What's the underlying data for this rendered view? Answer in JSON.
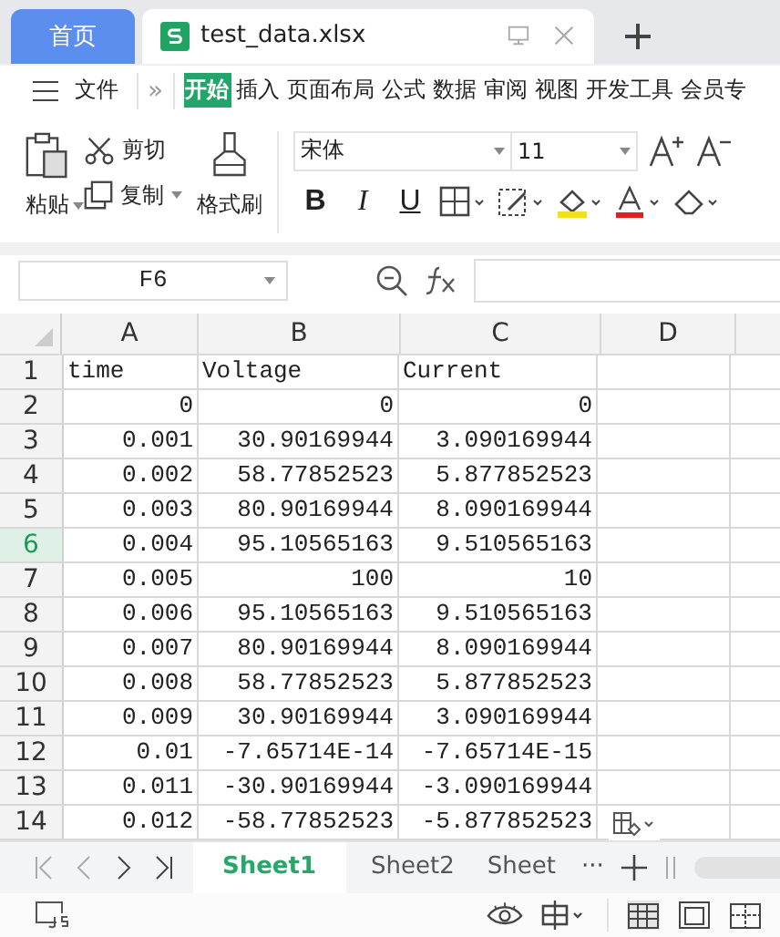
{
  "tabs": [
    {
      "label": "首页",
      "kind": "home",
      "selected": false
    },
    {
      "label": "test_data.xlsx",
      "kind": "doc",
      "selected": true
    }
  ],
  "menu": {
    "file": "文件",
    "more": "»",
    "items": [
      {
        "label": "开始",
        "selected": true
      },
      {
        "label": "插入",
        "selected": false
      },
      {
        "label": "页面布局",
        "selected": false
      },
      {
        "label": "公式",
        "selected": false
      },
      {
        "label": "数据",
        "selected": false
      },
      {
        "label": "审阅",
        "selected": false
      },
      {
        "label": "视图",
        "selected": false
      },
      {
        "label": "开发工具",
        "selected": false
      },
      {
        "label": "会员专",
        "selected": false
      }
    ]
  },
  "ribbon": {
    "paste": "粘贴",
    "cut": "剪切",
    "copy": "复制",
    "format_painter": "格式刷",
    "font": "宋体",
    "size": "11",
    "bold": "B",
    "italic": "I",
    "underline": "U"
  },
  "name_box": "F6",
  "columns": [
    "A",
    "B",
    "C",
    "D"
  ],
  "rows": [
    {
      "n": "1",
      "selected": false,
      "cells": [
        "time",
        "Voltage",
        "Current"
      ]
    },
    {
      "n": "2",
      "selected": false,
      "cells": [
        "0",
        "0",
        "0"
      ]
    },
    {
      "n": "3",
      "selected": false,
      "cells": [
        "0.001",
        "30.90169944",
        "3.090169944"
      ]
    },
    {
      "n": "4",
      "selected": false,
      "cells": [
        "0.002",
        "58.77852523",
        "5.877852523"
      ]
    },
    {
      "n": "5",
      "selected": false,
      "cells": [
        "0.003",
        "80.90169944",
        "8.090169944"
      ]
    },
    {
      "n": "6",
      "selected": true,
      "cells": [
        "0.004",
        "95.10565163",
        "9.510565163"
      ]
    },
    {
      "n": "7",
      "selected": false,
      "cells": [
        "0.005",
        "100",
        "10"
      ]
    },
    {
      "n": "8",
      "selected": false,
      "cells": [
        "0.006",
        "95.10565163",
        "9.510565163"
      ]
    },
    {
      "n": "9",
      "selected": false,
      "cells": [
        "0.007",
        "80.90169944",
        "8.090169944"
      ]
    },
    {
      "n": "10",
      "selected": false,
      "cells": [
        "0.008",
        "58.77852523",
        "5.877852523"
      ]
    },
    {
      "n": "11",
      "selected": false,
      "cells": [
        "0.009",
        "30.90169944",
        "3.090169944"
      ]
    },
    {
      "n": "12",
      "selected": false,
      "cells": [
        "0.01",
        "-7.65714E-14",
        "-7.65714E-15"
      ]
    },
    {
      "n": "13",
      "selected": false,
      "cells": [
        "0.011",
        "-30.90169944",
        "-3.090169944"
      ]
    },
    {
      "n": "14",
      "selected": false,
      "cells": [
        "0.012",
        "-58.77852523",
        "-5.877852523"
      ]
    }
  ],
  "sheets": [
    {
      "label": "Sheet1",
      "selected": true
    },
    {
      "label": "Sheet2",
      "selected": false
    },
    {
      "label": "Sheet",
      "selected": false
    }
  ],
  "sheet_more": "···"
}
